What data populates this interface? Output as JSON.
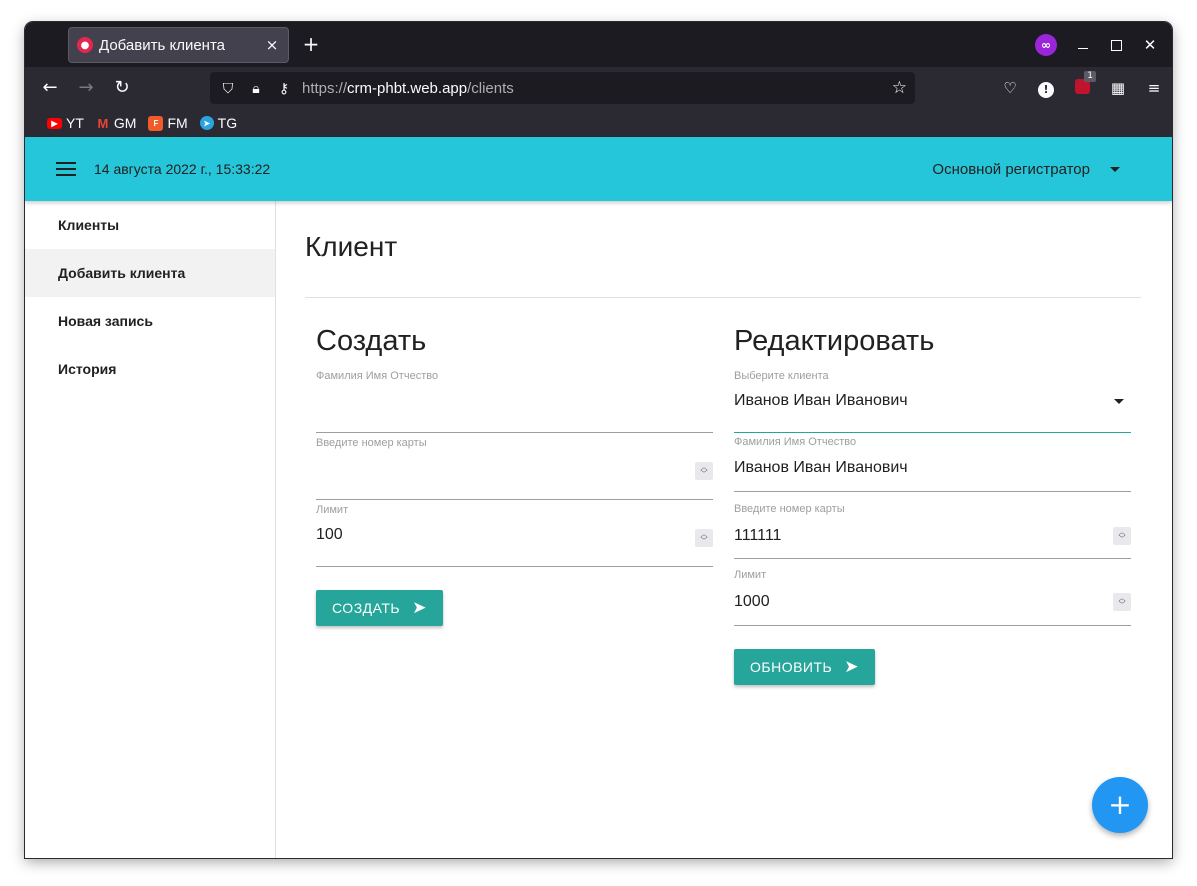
{
  "browser": {
    "tab_title": "Добавить клиента",
    "tab_close": "×",
    "new_tab": "+",
    "url_proto": "https://",
    "url_host": "crm-phbt.web.app",
    "url_path": "/clients",
    "toolbar_badge": "1",
    "bookmarks": [
      {
        "label": "YT",
        "icon": "youtube-icon"
      },
      {
        "label": "GM",
        "icon": "gmail-icon"
      },
      {
        "label": "FM",
        "icon": "fm-icon"
      },
      {
        "label": "TG",
        "icon": "telegram-icon"
      }
    ]
  },
  "header": {
    "datetime": "14 августа 2022 г., 15:33:22",
    "registrar": "Основной регистратор"
  },
  "sidebar": {
    "items": [
      {
        "label": "Клиенты",
        "active": false
      },
      {
        "label": "Добавить клиента",
        "active": true
      },
      {
        "label": "Новая запись",
        "active": false
      },
      {
        "label": "История",
        "active": false
      }
    ]
  },
  "main": {
    "title": "Клиент",
    "create": {
      "heading": "Создать",
      "fio_label": "Фамилия Имя Отчество",
      "fio_value": "",
      "card_label": "Введите номер карты",
      "card_value": "",
      "limit_label": "Лимит",
      "limit_value": "100",
      "button": "СОЗДАТЬ"
    },
    "edit": {
      "heading": "Редактировать",
      "select_label": "Выберите клиента",
      "select_value": "Иванов Иван Иванович",
      "fio_label": "Фамилия Имя Отчество",
      "fio_value": "Иванов Иван Иванович",
      "card_label": "Введите номер карты",
      "card_value": "111111",
      "limit_label": "Лимит",
      "limit_value": "1000",
      "button": "ОБНОВИТЬ"
    }
  },
  "fab": "+",
  "colors": {
    "header": "#26c6da",
    "button": "#26a69a",
    "fab": "#2196f3"
  }
}
